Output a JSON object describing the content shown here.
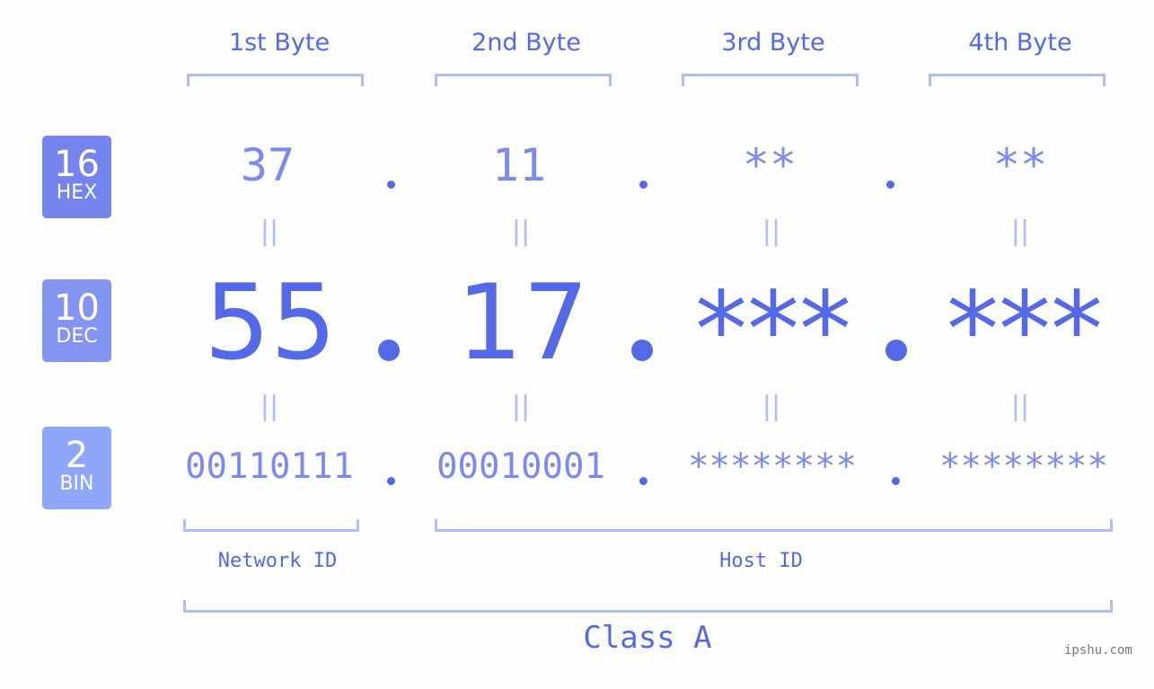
{
  "byte_headers": [
    "1st Byte",
    "2nd Byte",
    "3rd Byte",
    "4th Byte"
  ],
  "badges": {
    "hex": {
      "number": "16",
      "label": "HEX",
      "color": "#7584ec"
    },
    "dec": {
      "number": "10",
      "label": "DEC",
      "color": "#8394f1"
    },
    "bin": {
      "number": "2",
      "label": "BIN",
      "color": "#8ea7f8"
    }
  },
  "hex_values": [
    "37",
    "11",
    "**",
    "**"
  ],
  "dec_values": [
    "55",
    "17",
    "***",
    "***"
  ],
  "bin_values": [
    "00110111",
    "00010001",
    "********",
    "********"
  ],
  "equals_symbol": "||",
  "network_id_label": "Network ID",
  "host_id_label": "Host ID",
  "class_label": "Class A",
  "watermark": "ipshu.com",
  "colors": {
    "primary": "#5469e8",
    "secondary": "#7b8aec",
    "bracket": "#b3bcf5"
  }
}
